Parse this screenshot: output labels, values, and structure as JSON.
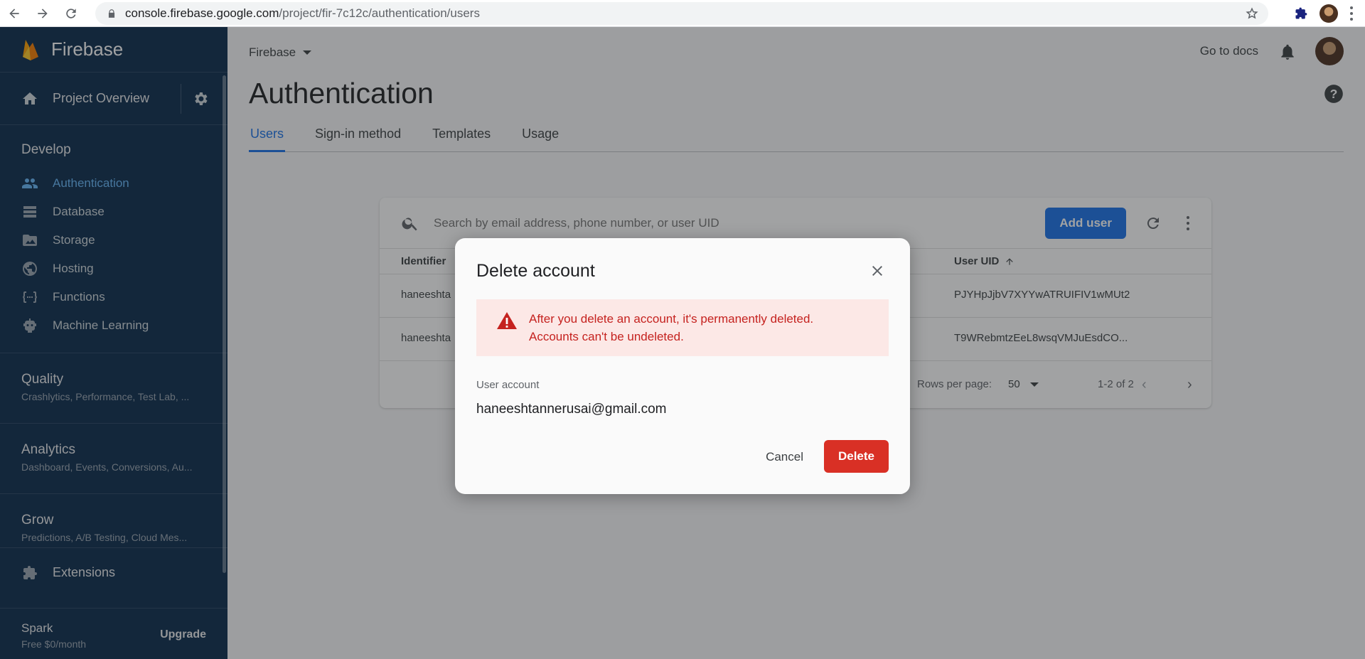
{
  "browser": {
    "url_host": "console.firebase.google.com",
    "url_path": "/project/fir-7c12c/authentication/users"
  },
  "sidebar": {
    "brand": "Firebase",
    "overview_label": "Project Overview",
    "develop_title": "Develop",
    "develop_items": [
      {
        "label": "Authentication",
        "icon": "people-icon",
        "active": true
      },
      {
        "label": "Database",
        "icon": "database-icon"
      },
      {
        "label": "Storage",
        "icon": "image-icon"
      },
      {
        "label": "Hosting",
        "icon": "globe-icon"
      },
      {
        "label": "Functions",
        "icon": "functions-icon"
      },
      {
        "label": "Machine Learning",
        "icon": "robot-icon"
      }
    ],
    "groups": [
      {
        "title": "Quality",
        "subtitle": "Crashlytics, Performance, Test Lab, ..."
      },
      {
        "title": "Analytics",
        "subtitle": "Dashboard, Events, Conversions, Au..."
      },
      {
        "title": "Grow",
        "subtitle": "Predictions, A/B Testing, Cloud Mes..."
      }
    ],
    "extensions_label": "Extensions",
    "plan_name": "Spark",
    "plan_price": "Free $0/month",
    "upgrade_label": "Upgrade"
  },
  "header": {
    "project": "Firebase",
    "go_to_docs": "Go to docs",
    "page_title": "Authentication"
  },
  "tabs": [
    {
      "label": "Users",
      "active": true
    },
    {
      "label": "Sign-in method"
    },
    {
      "label": "Templates"
    },
    {
      "label": "Usage"
    }
  ],
  "users_card": {
    "search_placeholder": "Search by email address, phone number, or user UID",
    "add_user_label": "Add user",
    "col_identifier": "Identifier",
    "col_uid": "User UID",
    "rows": [
      {
        "identifier": "haneeshta",
        "uid": "PJYHpJjbV7XYYwATRUIFIV1wMUt2"
      },
      {
        "identifier": "haneeshta",
        "uid": "T9WRebmtzEeL8wsqVMJuEsdCO..."
      }
    ],
    "rows_per_page_label": "Rows per page:",
    "rows_per_page_value": "50",
    "range": "1-2 of 2"
  },
  "dialog": {
    "title": "Delete account",
    "warning_line1": "After you delete an account, it's permanently deleted.",
    "warning_line2": "Accounts can't be undeleted.",
    "account_label": "User account",
    "account_email": "haneeshtannerusai@gmail.com",
    "cancel_label": "Cancel",
    "delete_label": "Delete"
  },
  "colors": {
    "sidebar_bg": "#0b2b4d",
    "accent": "#1a73e8",
    "danger": "#d93025",
    "warning_bg": "#fce8e6"
  }
}
